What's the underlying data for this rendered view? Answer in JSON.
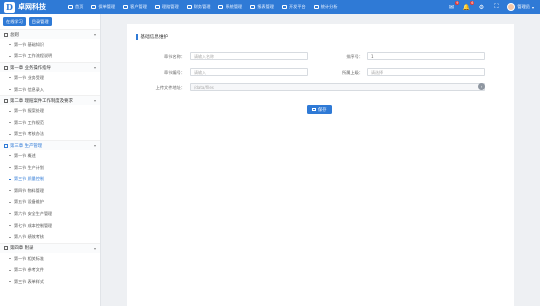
{
  "app": {
    "logo_letter": "D",
    "title": "卓网科技"
  },
  "topnav": [
    {
      "label": "首页"
    },
    {
      "label": "保单管理"
    },
    {
      "label": "客户管理"
    },
    {
      "label": "理赔管理"
    },
    {
      "label": "财务管理"
    },
    {
      "label": "系统管理"
    },
    {
      "label": "报表管理"
    },
    {
      "label": "开发平台"
    },
    {
      "label": "统计分析"
    }
  ],
  "tools": {
    "mail_badge": "9",
    "bell_badge": "6",
    "user_name": "管理员"
  },
  "sidebar": {
    "buttons": [
      "在线学习",
      "目录管理"
    ],
    "groups": [
      {
        "title": "总则",
        "active": false,
        "items": [
          "第一节 基础知识",
          "第二节 工作流程说明"
        ]
      },
      {
        "title": "第一章 业务操作指导",
        "active": false,
        "items": [
          "第一节 业务受理",
          "第二节 信息录入"
        ]
      },
      {
        "title": "第二章 理赔案件工作制度及要求",
        "active": false,
        "items": [
          "第一节 报案处理",
          "第二节 工作规范",
          "第三节 考核办法"
        ]
      },
      {
        "title": "第三章 生产管理",
        "active": true,
        "items": [
          "第一节 概述",
          "第二节 生产计划",
          "第三节 质量控制",
          "第四节 物料管理",
          "第五节 设备维护",
          "第六节 安全生产管理",
          "第七节 成本控制管理",
          "第八节 绩效考核"
        ]
      },
      {
        "title": "第四章 附录",
        "active": false,
        "items": [
          "第一节 相关标准",
          "第二节 参考文件",
          "第三节 表单样式"
        ]
      }
    ],
    "active_item": "第三节 质量控制"
  },
  "form": {
    "title": "基础信息维护",
    "fields": {
      "name": {
        "label": "章节名称：",
        "placeholder": "请输入名称"
      },
      "sort": {
        "label": "排序号：",
        "value": "1"
      },
      "code": {
        "label": "章节编号：",
        "placeholder": "请输入"
      },
      "parent": {
        "label": "所属上级：",
        "placeholder": "请选择"
      },
      "path": {
        "label": "上传文件地址：",
        "value": "/data/files"
      }
    },
    "save_label": "保存"
  },
  "colors": {
    "primary": "#2f7ad6",
    "background": "#eef0f3"
  }
}
